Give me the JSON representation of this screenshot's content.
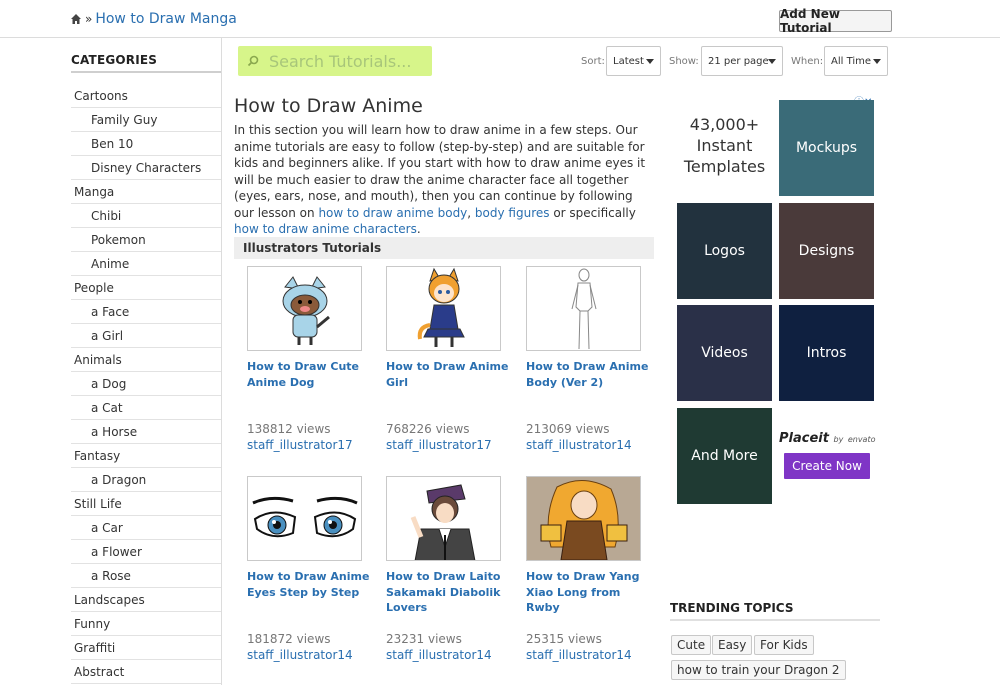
{
  "header": {
    "breadcrumb_sep": "»",
    "breadcrumb_link": "How to Draw Manga",
    "add_button": "Add New Tutorial"
  },
  "sidebar": {
    "title": "CATEGORIES",
    "items": [
      {
        "label": "Cartoons",
        "level": "top"
      },
      {
        "label": "Family Guy",
        "level": "sub"
      },
      {
        "label": "Ben 10",
        "level": "sub"
      },
      {
        "label": "Disney Characters",
        "level": "sub"
      },
      {
        "label": "Manga",
        "level": "top"
      },
      {
        "label": "Chibi",
        "level": "sub"
      },
      {
        "label": "Pokemon",
        "level": "sub"
      },
      {
        "label": "Anime",
        "level": "sub"
      },
      {
        "label": "People",
        "level": "top"
      },
      {
        "label": "a Face",
        "level": "sub"
      },
      {
        "label": "a Girl",
        "level": "sub"
      },
      {
        "label": "Animals",
        "level": "top"
      },
      {
        "label": "a Dog",
        "level": "sub"
      },
      {
        "label": "a Cat",
        "level": "sub"
      },
      {
        "label": "a Horse",
        "level": "sub"
      },
      {
        "label": "Fantasy",
        "level": "top"
      },
      {
        "label": "a Dragon",
        "level": "sub"
      },
      {
        "label": "Still Life",
        "level": "top"
      },
      {
        "label": "a Car",
        "level": "sub"
      },
      {
        "label": "a Flower",
        "level": "sub"
      },
      {
        "label": "a Rose",
        "level": "sub"
      },
      {
        "label": "Landscapes",
        "level": "top"
      },
      {
        "label": "Funny",
        "level": "top"
      },
      {
        "label": "Graffiti",
        "level": "top"
      },
      {
        "label": "Abstract",
        "level": "top"
      }
    ]
  },
  "toolbar": {
    "search_placeholder": "Search Tutorials...",
    "sort_label": "Sort:",
    "sort_value": "Latest",
    "show_label": "Show:",
    "show_value": "21 per page",
    "when_label": "When:",
    "when_value": "All Time"
  },
  "main": {
    "title": "How to Draw Anime",
    "intro_1": "In this section you will learn how to draw anime in a few steps. Our anime tutorials are easy to follow (step-by-step) and are suitable for kids and beginners alike. If you start with how to draw anime eyes it will be much easier to draw the anime character face all together (eyes, ears, nose, and mouth), then you can continue by following our lesson on ",
    "intro_link_1": "how to draw anime body",
    "intro_2": ", ",
    "intro_link_2": "body figures",
    "intro_3": " or specifically ",
    "intro_link_3": "how to draw anime characters",
    "intro_4": ".",
    "section_title": "Illustrators Tutorials",
    "cards": [
      {
        "title": "How to Draw Cute Anime Dog",
        "views": "138812 views",
        "author": "staff_illustrator17",
        "thumb": "dog-icon"
      },
      {
        "title": "How to Draw Anime Girl",
        "views": "768226 views",
        "author": "staff_illustrator17",
        "thumb": "girl-icon"
      },
      {
        "title": "How to Draw Anime Body (Ver 2)",
        "views": "213069 views",
        "author": "staff_illustrator14",
        "thumb": "body-icon"
      },
      {
        "title": "How to Draw Anime Eyes Step by Step",
        "views": "181872 views",
        "author": "staff_illustrator14",
        "thumb": "eyes-icon"
      },
      {
        "title": "How to Draw Laito Sakamaki Diabolik Lovers",
        "views": "23231 views",
        "author": "staff_illustrator14",
        "thumb": "boy-icon"
      },
      {
        "title": "How to Draw Yang Xiao Long from Rwby",
        "views": "25315 views",
        "author": "staff_illustrator14",
        "thumb": "yang-icon"
      }
    ]
  },
  "ads": {
    "headline": "43,000+ Instant Templates",
    "tiles": [
      {
        "label": "Mockups",
        "color": "#3a6b78"
      },
      {
        "label": "Logos",
        "color": "#22323e"
      },
      {
        "label": "Designs",
        "color": "#4a3a3a"
      },
      {
        "label": "Videos",
        "color": "#2a3048"
      },
      {
        "label": "Intros",
        "color": "#0f2040"
      },
      {
        "label": "And More",
        "color": "#1f3a33"
      }
    ],
    "brand": "Placeit",
    "brand_by": "by",
    "brand_owner": "envato",
    "cta": "Create Now",
    "cta_color": "#7f35c6",
    "adchoices": "ⓘ✕"
  },
  "trending": {
    "title": "TRENDING TOPICS",
    "tags": [
      "Cute",
      "Easy",
      "For Kids",
      "how to train your Dragon 2"
    ]
  },
  "colors": {
    "link": "#2a6fb0",
    "search_bg": "#d7f58a"
  }
}
